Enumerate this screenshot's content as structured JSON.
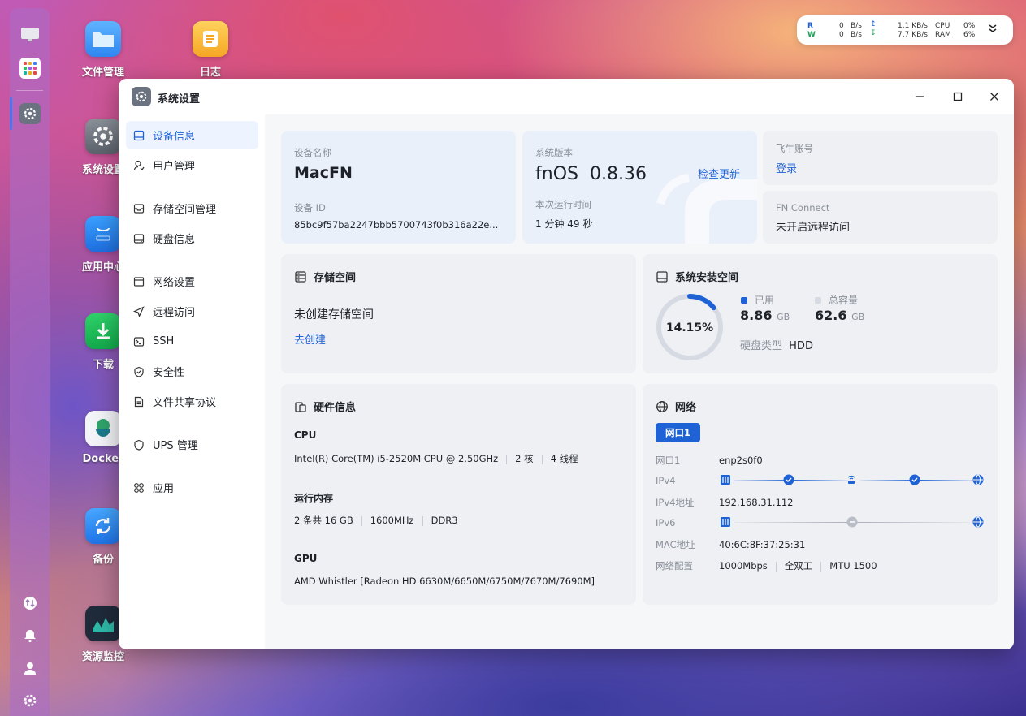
{
  "desktop": {
    "icons": [
      "文件管理",
      "日志",
      "系统设置",
      "应用中心",
      "下载",
      "Docker",
      "备份",
      "资源监控"
    ]
  },
  "monitor": {
    "r_label": "R",
    "w_label": "W",
    "r_rate_val": "0",
    "r_rate_unit": "B/s",
    "w_rate_val": "0",
    "w_rate_unit": "B/s",
    "up_val": "1.1 KB/s",
    "down_val": "7.7 KB/s",
    "cpu_label": "CPU",
    "cpu_val": "0%",
    "ram_label": "RAM",
    "ram_val": "6%"
  },
  "window": {
    "title": "系统设置"
  },
  "sidebar": {
    "items": [
      {
        "label": "设备信息"
      },
      {
        "label": "用户管理"
      },
      {
        "label": "存储空间管理"
      },
      {
        "label": "硬盘信息"
      },
      {
        "label": "网络设置"
      },
      {
        "label": "远程访问"
      },
      {
        "label": "SSH"
      },
      {
        "label": "安全性"
      },
      {
        "label": "文件共享协议"
      },
      {
        "label": "UPS 管理"
      },
      {
        "label": "应用"
      }
    ]
  },
  "device": {
    "name_label": "设备名称",
    "name": "MacFN",
    "id_label": "设备 ID",
    "id": "85bc9f57ba2247bbb5700743f0b316a22e..."
  },
  "version": {
    "label": "系统版本",
    "os": "fnOS",
    "number": "0.8.36",
    "check_update": "检查更新",
    "uptime_label": "本次运行时间",
    "uptime": "1 分钟 49 秒"
  },
  "account": {
    "label": "飞牛账号",
    "login": "登录"
  },
  "fnconnect": {
    "label": "FN Connect",
    "status": "未开启远程访问"
  },
  "storage": {
    "title": "存储空间",
    "status": "未创建存储空间",
    "create": "去创建"
  },
  "sysinstall": {
    "title": "系统安装空间",
    "percent_text": "14.15%",
    "percent": 0.1415,
    "used_label": "已用",
    "used_val": "8.86",
    "used_unit": "GB",
    "total_label": "总容量",
    "total_val": "62.6",
    "total_unit": "GB",
    "disk_type_label": "硬盘类型",
    "disk_type": "HDD",
    "colors": {
      "used": "#1e62d6",
      "track": "#d6dae2"
    }
  },
  "hardware": {
    "title": "硬件信息",
    "cpu_label": "CPU",
    "cpu_model": "Intel(R) Core(TM) i5-2520M CPU @ 2.50GHz",
    "cpu_cores": "2 核",
    "cpu_threads": "4 线程",
    "mem_label": "运行内存",
    "mem_size": "2 条共 16 GB",
    "mem_speed": "1600MHz",
    "mem_type": "DDR3",
    "gpu_label": "GPU",
    "gpu_model": "AMD Whistler [Radeon HD 6630M/6650M/6750M/7670M/7690M]"
  },
  "network": {
    "title": "网络",
    "tab": "网口1",
    "port_label": "网口1",
    "port_val": "enp2s0f0",
    "ipv4_label": "IPv4",
    "ipv4addr_label": "IPv4地址",
    "ipv4addr_val": "192.168.31.112",
    "ipv6_label": "IPv6",
    "mac_label": "MAC地址",
    "mac_val": "40:6C:8F:37:25:31",
    "config_label": "网络配置",
    "speed": "1000Mbps",
    "duplex": "全双工",
    "mtu": "MTU 1500"
  }
}
